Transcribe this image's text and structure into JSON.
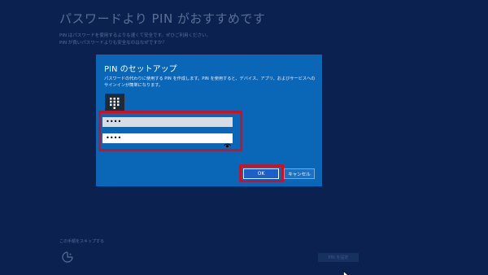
{
  "background": {
    "title": "パスワードより PIN がおすすめです",
    "desc_line1": "PIN はパスワードを使用するよりも速くて安全です。ぜひご利用ください。",
    "desc_line2": "PIN が良いパスワードよりも安全なのはなぜですか？",
    "skip_link": "この手順をスキップする",
    "next_label": "PIN を設定",
    "ease_icon": "ease-of-access-icon"
  },
  "dialog": {
    "title": "PIN のセットアップ",
    "desc_line1": "パスワードの代わりに使用する PIN を作成します。PIN を使用すると、デバイス、アプリ、およびサービスへの",
    "desc_line2": "サインインが簡単になります。",
    "keypad_icon": "keypad-icon",
    "new_pin_value": "••••",
    "confirm_pin_value": "••••",
    "reveal_icon": "eye-icon",
    "ok_label": "OK",
    "cancel_label": "キャンセル"
  },
  "colors": {
    "page_bg": "#0b2150",
    "dialog_bg": "#0a66b7",
    "highlight": "#d0101d",
    "ok_button": "#1d5fc7"
  }
}
